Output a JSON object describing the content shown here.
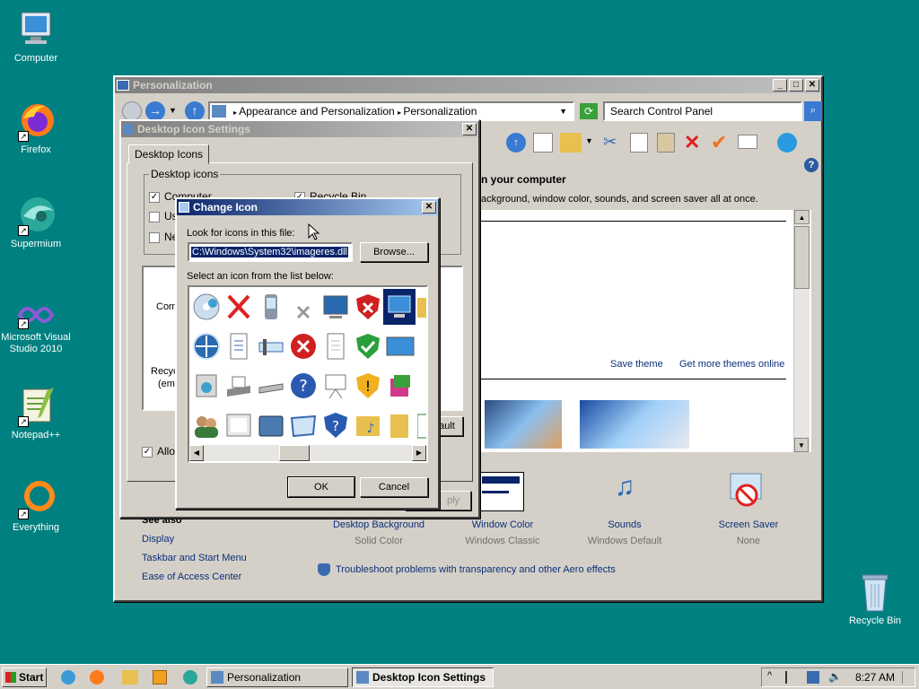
{
  "desktop_icons": [
    {
      "label": "Computer",
      "icon": "computer-icon"
    },
    {
      "label": "Firefox",
      "icon": "firefox-icon"
    },
    {
      "label": "Supermium",
      "icon": "supermium-icon"
    },
    {
      "label": "Microsoft Visual Studio 2010",
      "icon": "visual-studio-icon"
    },
    {
      "label": "Notepad++",
      "icon": "notepadpp-icon"
    },
    {
      "label": "Everything",
      "icon": "everything-icon"
    },
    {
      "label": "Recycle Bin",
      "icon": "recycle-bin-icon"
    }
  ],
  "personalization": {
    "title": "Personalization",
    "breadcrumb": [
      "Appearance and Personalization",
      "Personalization"
    ],
    "search_placeholder": "Search Control Panel",
    "heading_partial": "n your computer",
    "desc_partial": "ackground, window color, sounds, and screen saver all at once.",
    "save_theme": "Save theme",
    "more_themes": "Get more themes online",
    "see_also_partial": "See also",
    "see_also": [
      "Display",
      "Taskbar and Start Menu",
      "Ease of Access Center"
    ],
    "items": [
      {
        "label": "Desktop Background",
        "sub": "Solid Color"
      },
      {
        "label": "Window Color",
        "sub": "Windows Classic"
      },
      {
        "label": "Sounds",
        "sub": "Windows Default"
      },
      {
        "label": "Screen Saver",
        "sub": "None"
      }
    ],
    "troubleshoot": "Troubleshoot problems with transparency and other Aero effects"
  },
  "desktop_icon_settings": {
    "title": "Desktop Icon Settings",
    "tab": "Desktop Icons",
    "group": "Desktop icons",
    "checkboxes": [
      {
        "label": "Computer",
        "checked": true
      },
      {
        "label": "Us",
        "checked": false
      },
      {
        "label": "Ne",
        "checked": false
      },
      {
        "label": "Recycle Bin",
        "checked": true
      }
    ],
    "preview_labels": [
      "Comp",
      "Recyc",
      "(em"
    ],
    "allow_partial": "Allow",
    "default_partial": "ault",
    "apply_partial": "ply"
  },
  "change_icon": {
    "title": "Change Icon",
    "look_label": "Look for icons in this file:",
    "file_value": "C:\\Windows\\System32\\imageres.dll",
    "browse": "Browse...",
    "select_label": "Select an icon from the list below:",
    "ok": "OK",
    "cancel": "Cancel"
  },
  "taskbar": {
    "start": "Start",
    "tasks": [
      {
        "label": "Personalization",
        "active": false
      },
      {
        "label": "Desktop Icon Settings",
        "active": true
      }
    ],
    "clock": "8:27 AM"
  }
}
